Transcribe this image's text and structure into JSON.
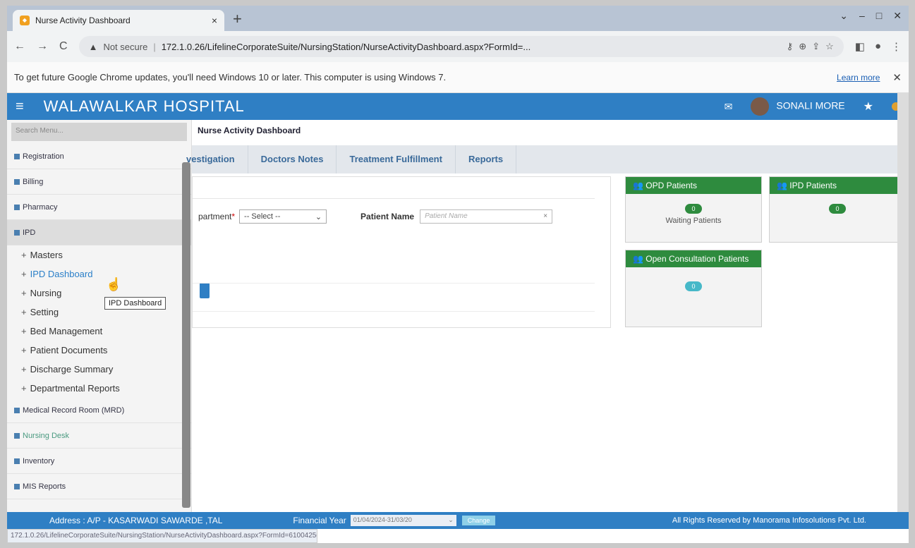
{
  "browser": {
    "tab_title": "Nurse Activity Dashboard",
    "tab_close": "×",
    "new_tab": "+",
    "nav": {
      "back": "←",
      "forward": "→",
      "reload": "C"
    },
    "security_warning": "▲",
    "security_text": "Not secure",
    "url": "172.1.0.26/LifelineCorporateSuite/NursingStation/NurseActivityDashboard.aspx?FormId=...",
    "infobar_message": "To get future Google Chrome updates, you'll need Windows 10 or later. This computer is using Windows 7.",
    "infobar_learn_more": "Learn more",
    "infobar_close": "✕",
    "status_url": "172.1.0.26/LifelineCorporateSuite/NursingStation/NurseActivityDashboard.aspx?FormId=6100425#"
  },
  "app": {
    "brand": "WALAWALKAR HOSPITAL",
    "menu_icon": "≡",
    "mail_icon": "✉",
    "star_icon": "★",
    "user_name": "SONALI MORE"
  },
  "sidebar": {
    "search_placeholder": "Search Menu...",
    "items": [
      {
        "label": "Registration"
      },
      {
        "label": "Billing"
      },
      {
        "label": "Pharmacy"
      },
      {
        "label": "IPD"
      }
    ],
    "ipd_sub": [
      {
        "label": "Masters"
      },
      {
        "label": "IPD Dashboard"
      },
      {
        "label": "Nursing"
      },
      {
        "label": "Setting"
      },
      {
        "label": "Bed Management"
      },
      {
        "label": "Patient Documents"
      },
      {
        "label": "Discharge Summary"
      },
      {
        "label": "Departmental Reports"
      }
    ],
    "items_after": [
      {
        "label": "Medical Record Room (MRD)"
      },
      {
        "label": "Nursing Desk"
      },
      {
        "label": "Inventory"
      },
      {
        "label": "MIS Reports"
      }
    ],
    "tooltip": "IPD Dashboard"
  },
  "main": {
    "breadcrumb": "Nurse Activity Dashboard",
    "tabs": [
      "vestigation",
      "Doctors Notes",
      "Treatment Fulfillment",
      "Reports"
    ],
    "form": {
      "department_label": "partment",
      "required_mark": "*",
      "department_value": "-- Select --",
      "patient_name_label": "Patient Name",
      "patient_name_placeholder": "Patient Name",
      "clear": "×"
    },
    "cards": [
      {
        "title": "OPD Patients",
        "count": "0",
        "caption": "Waiting Patients"
      },
      {
        "title": "IPD Patients",
        "count": "0",
        "caption": ""
      },
      {
        "title": "Open Consultation Patients",
        "count": "0",
        "caption": ""
      }
    ]
  },
  "footer": {
    "address": "Address : A/P - KASARWADI SAWARDE ,TAL",
    "fy_label": "Financial Year",
    "fy_value": "01/04/2024-31/03/20",
    "change_button": "Change",
    "rights": "All Rights Reserved by Manorama Infosolutions Pvt. Ltd."
  }
}
